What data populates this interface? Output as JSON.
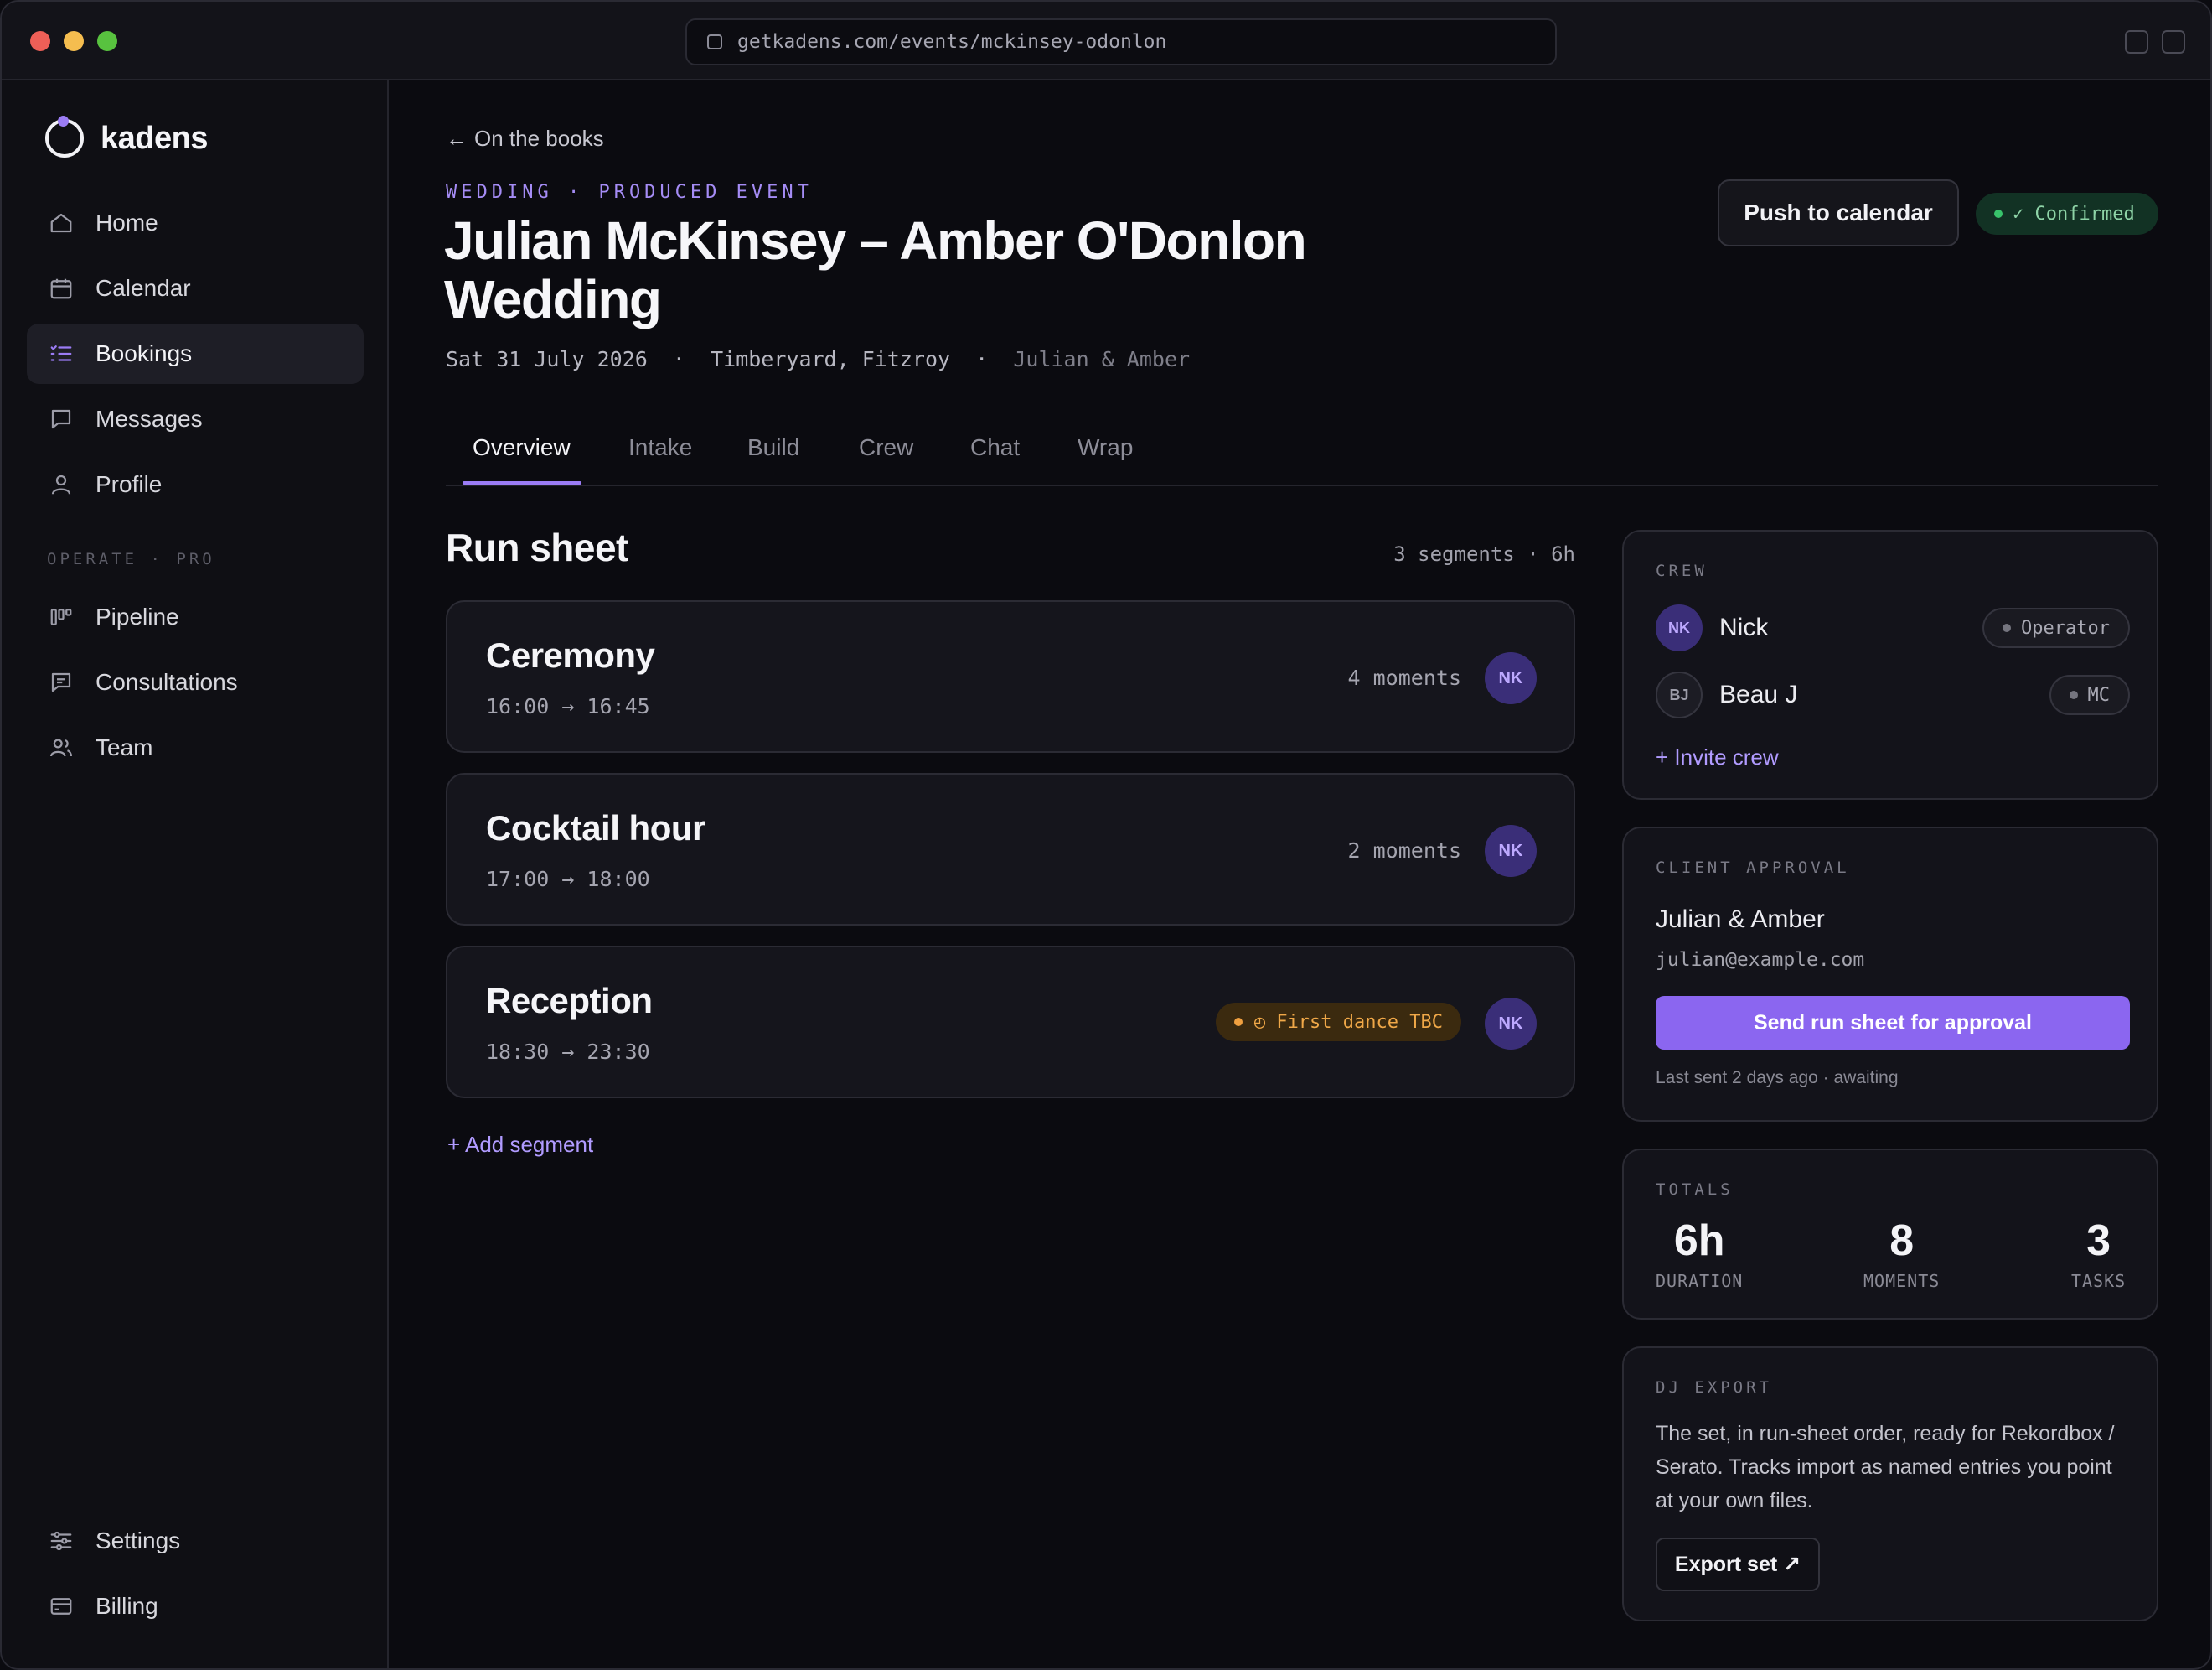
{
  "browser": {
    "url": "getkadens.com/events/mckinsey-odonlon"
  },
  "brand": {
    "name": "kadens",
    "accent": "#9b7cf5"
  },
  "sidebar": {
    "items": [
      {
        "label": "Home",
        "icon": "home-icon"
      },
      {
        "label": "Calendar",
        "icon": "calendar-icon"
      },
      {
        "label": "Bookings",
        "icon": "list-icon",
        "active": true
      },
      {
        "label": "Messages",
        "icon": "message-icon"
      },
      {
        "label": "Profile",
        "icon": "user-icon"
      }
    ],
    "section_label": "OPERATE · PRO",
    "pro_items": [
      {
        "label": "Pipeline",
        "icon": "kanban-icon"
      },
      {
        "label": "Consultations",
        "icon": "chat-bubble-icon"
      },
      {
        "label": "Team",
        "icon": "team-icon"
      }
    ],
    "bottom_items": [
      {
        "label": "Settings",
        "icon": "sliders-icon"
      },
      {
        "label": "Billing",
        "icon": "card-icon"
      }
    ]
  },
  "header": {
    "back_label": "On the books",
    "eyebrow": "WEDDING · PRODUCED EVENT",
    "title": "Julian McKinsey – Amber O'Donlon Wedding",
    "meta_date": "Sat 31 July 2026",
    "meta_venue": "Timberyard, Fitzroy",
    "meta_client": "Julian & Amber",
    "push_label": "Push to calendar",
    "status_label": "✓ Confirmed",
    "status_color": "#38c46b"
  },
  "tabs": [
    "Overview",
    "Intake",
    "Build",
    "Crew",
    "Chat",
    "Wrap"
  ],
  "run_sheet": {
    "title": "Run sheet",
    "summary": "3 segments · 6h",
    "segments": [
      {
        "name": "Ceremony",
        "time": "16:00 → 16:45",
        "moments": "4 moments",
        "avatar": "NK"
      },
      {
        "name": "Cocktail hour",
        "time": "17:00 → 18:00",
        "moments": "2 moments",
        "avatar": "NK"
      },
      {
        "name": "Reception",
        "time": "18:30 → 23:30",
        "flag": "◴ First dance TBC",
        "avatar": "NK"
      }
    ],
    "add_label": "+ Add segment"
  },
  "crew": {
    "label": "CREW",
    "members": [
      {
        "initials": "NK",
        "name": "Nick",
        "role": "Operator"
      },
      {
        "initials": "BJ",
        "name": "Beau J",
        "role": "MC"
      }
    ],
    "invite_label": "+ Invite crew"
  },
  "client_approval": {
    "label": "CLIENT APPROVAL",
    "name": "Julian & Amber",
    "email": "julian@example.com",
    "button_label": "Send run sheet for approval",
    "last_sent": "Last sent 2 days ago · awaiting"
  },
  "totals": {
    "label": "TOTALS",
    "stats": [
      {
        "value": "6h",
        "label": "DURATION"
      },
      {
        "value": "8",
        "label": "MOMENTS"
      },
      {
        "value": "3",
        "label": "TASKS"
      }
    ]
  },
  "dj_export": {
    "label": "DJ EXPORT",
    "text": "The set, in run-sheet order, ready for Rekordbox / Serato. Tracks import as named entries you point at your own files.",
    "button_label": "Export set ↗"
  }
}
